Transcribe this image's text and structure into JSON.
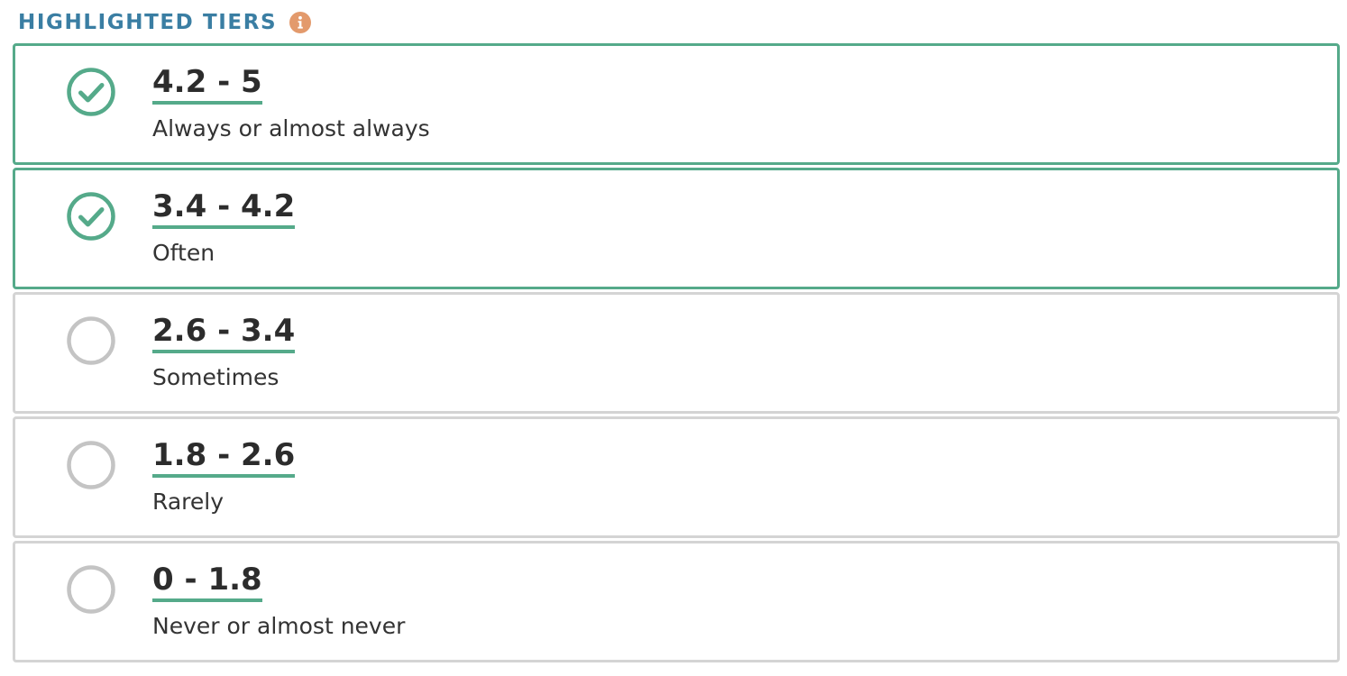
{
  "header": {
    "title": "HIGHLIGHTED TIERS",
    "info_icon": "info-icon"
  },
  "colors": {
    "accent": "#55aa8a",
    "title": "#3a7ea3",
    "info": "#e39a6c",
    "unselected_border": "#d4d4d4"
  },
  "tiers": [
    {
      "range": "4.2 - 5",
      "label": "Always or almost always",
      "selected": true
    },
    {
      "range": "3.4 - 4.2",
      "label": "Often",
      "selected": true
    },
    {
      "range": "2.6 - 3.4",
      "label": "Sometimes",
      "selected": false
    },
    {
      "range": "1.8 - 2.6",
      "label": "Rarely",
      "selected": false
    },
    {
      "range": "0 - 1.8",
      "label": "Never or almost never",
      "selected": false
    }
  ]
}
